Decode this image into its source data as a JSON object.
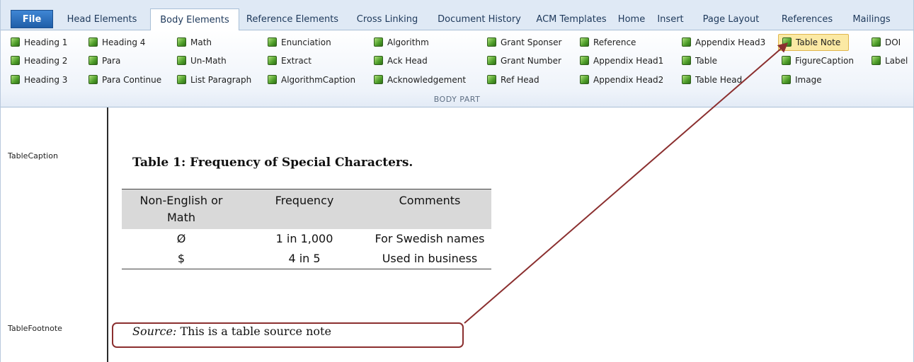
{
  "tabs": [
    "File",
    "Head Elements",
    "Body Elements",
    "Reference Elements",
    "Cross Linking",
    "Document History",
    "ACM Templates",
    "Home",
    "Insert",
    "Page Layout",
    "References",
    "Mailings"
  ],
  "ribbon": {
    "items": [
      "Heading 1",
      "Heading 2",
      "Heading 3",
      "Heading 4",
      "Para",
      "Para Continue",
      "Math",
      "Un-Math",
      "List Paragraph",
      "Enunciation",
      "Extract",
      "AlgorithmCaption",
      "Algorithm",
      "Ack Head",
      "Acknowledgement",
      "Grant Sponser",
      "Grant Number",
      "Ref Head",
      "Reference",
      "Appendix Head1",
      "Appendix Head2",
      "Appendix Head3",
      "Table",
      "Table Head",
      "Table Note",
      "FigureCaption",
      "Image",
      "DOI",
      "Label"
    ],
    "group_label": "BODY PART",
    "highlighted": "Table Note"
  },
  "styles": {
    "caption_style": "TableCaption",
    "footnote_style": "TableFootnote"
  },
  "document": {
    "caption": "Table 1: Frequency of Special Characters.",
    "headers": [
      "Non-English or Math",
      "Frequency",
      "Comments"
    ],
    "rows": [
      [
        "Ø",
        "1 in 1,000",
        "For Swedish names"
      ],
      [
        "$",
        "4 in 5",
        "Used in business"
      ]
    ],
    "note_label": "Source:",
    "note_text": " This is a table source note"
  },
  "colors": {
    "annotation": "#8b2f2f",
    "highlight": "#fbe9a4",
    "accent": "#2b579a"
  }
}
